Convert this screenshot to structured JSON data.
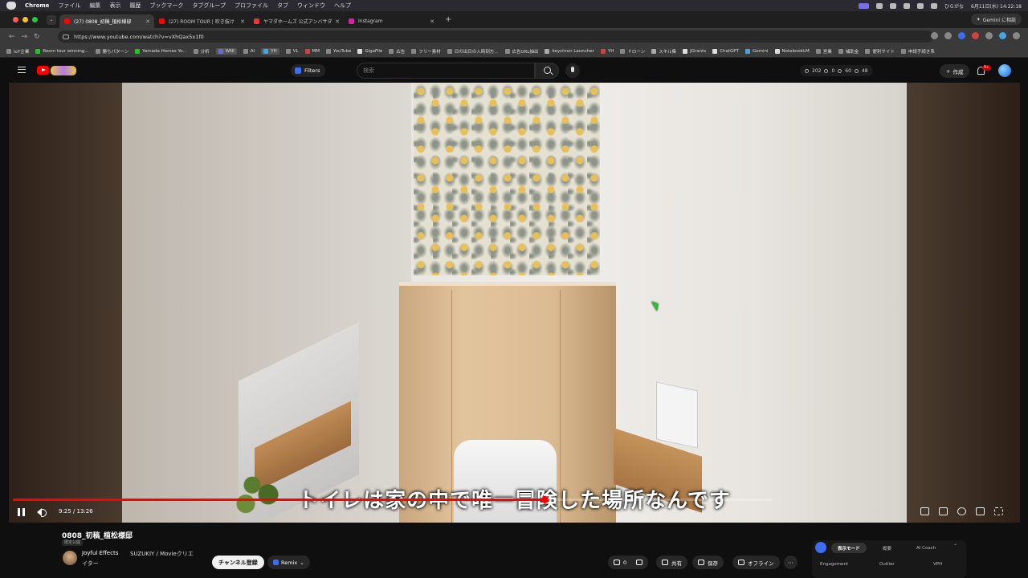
{
  "menubar": {
    "app": "Chrome",
    "items": [
      "ファイル",
      "編集",
      "表示",
      "履歴",
      "ブックマーク",
      "タブグループ",
      "プロファイル",
      "タブ",
      "ウィンドウ",
      "ヘルプ"
    ],
    "right": {
      "ime": "ひらがな",
      "datetime": "6月11日(水) 14:22:18"
    }
  },
  "tabs": [
    {
      "title": "(27) 0808_初稿_植松様邸",
      "active": true,
      "favicon_color": "#ff0000"
    },
    {
      "title": "(27) ROOM TOUR | 吹き抜け",
      "active": false,
      "favicon_color": "#ff0000"
    },
    {
      "title": "ヤマダホームズ 公式アンバサダ",
      "active": false,
      "favicon_color": "#e23a3a"
    },
    {
      "title": "Instagram",
      "active": false,
      "favicon_color": "#d6249f"
    }
  ],
  "gemini_button": "Gemini に相談",
  "address": {
    "url": "https://www.youtube.com/watch?v=vXhQax5x1f0"
  },
  "bookmarks": [
    {
      "label": "IoT企業",
      "color": "#888"
    },
    {
      "label": "Room tour winning...",
      "color": "#2bbf2b"
    },
    {
      "label": "勝ちパターン",
      "color": "#888"
    },
    {
      "label": "Yamada Homes Yo...",
      "color": "#2bbf2b"
    },
    {
      "label": "分析",
      "color": "#888"
    },
    {
      "label": "WNI",
      "color": "#6b6bd6"
    },
    {
      "label": "AI",
      "color": "#888"
    },
    {
      "label": "YH",
      "color": "#4aa3df"
    },
    {
      "label": "VL",
      "color": "#888"
    },
    {
      "label": "MM",
      "color": "#c44"
    },
    {
      "label": "YouTube",
      "color": "#888"
    },
    {
      "label": "GigaFile",
      "color": "#ddd"
    },
    {
      "label": "広告",
      "color": "#888"
    },
    {
      "label": "フリー素材",
      "color": "#888"
    },
    {
      "label": "日の出日の入時刻方...",
      "color": "#888"
    },
    {
      "label": "広告URL抽出",
      "color": "#888"
    },
    {
      "label": "keychron Launcher",
      "color": "#aaa"
    },
    {
      "label": "YH",
      "color": "#c44"
    },
    {
      "label": "ドローン",
      "color": "#888"
    },
    {
      "label": "スキル集",
      "color": "#aaa"
    },
    {
      "label": "JGrants",
      "color": "#ddd"
    },
    {
      "label": "ChatGPT",
      "color": "#ddd"
    },
    {
      "label": "Gemini",
      "color": "#4aa3df"
    },
    {
      "label": "NotebookLM",
      "color": "#ddd"
    },
    {
      "label": "営業",
      "color": "#888"
    },
    {
      "label": "補助金",
      "color": "#888"
    },
    {
      "label": "便利サイト",
      "color": "#888"
    },
    {
      "label": "申請手続き系",
      "color": "#888"
    }
  ],
  "yt": {
    "filters": "Filters",
    "search_placeholder": "検索",
    "stats": {
      "a": "202",
      "b": "0",
      "c": "60",
      "d": "48"
    },
    "create": "作成",
    "notifications": "9+"
  },
  "player": {
    "subtitle": "トイレは家の中で唯一冒険した場所なんです",
    "time": "9:25 / 13:26",
    "progress_fraction": 0.7
  },
  "video": {
    "title": "0808_初稿_植松様邸",
    "visibility": "限定公開",
    "channel": "Joyful Effects",
    "channel_meta_line1": "SUZUKIY / Movieクリエ",
    "channel_meta_line2": "イター",
    "subscribe": "チャンネル登録",
    "remix": "Remix",
    "likes": "0",
    "share": "共有",
    "save": "保存",
    "offline": "オフライン"
  },
  "panel": {
    "tabs": [
      "表示モード",
      "概要",
      "AI Coach"
    ],
    "labels": [
      "Engagement",
      "Outlier",
      "VPH"
    ]
  }
}
